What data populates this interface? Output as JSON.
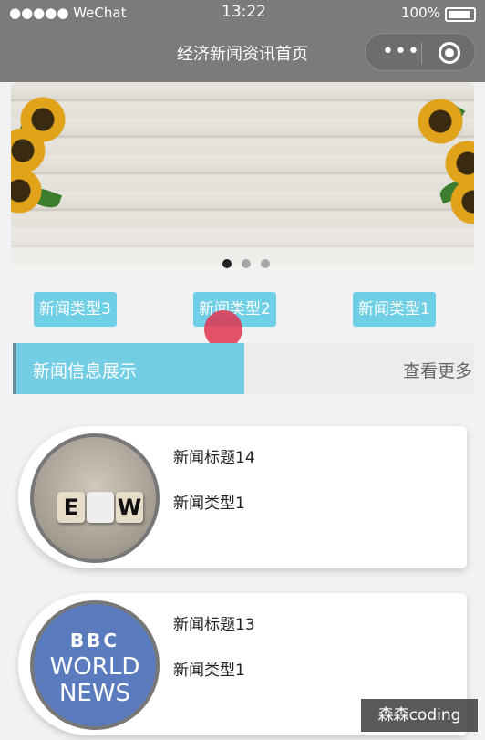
{
  "status_bar": {
    "carrier": "●●●●● WeChat",
    "time": "13:22",
    "battery": "100%"
  },
  "nav": {
    "title": "经济新闻资讯首页",
    "more_icon": "more-dots-icon",
    "close_icon": "target-icon"
  },
  "banner": {
    "indicator_count": 3,
    "active_index": 0
  },
  "categories": [
    {
      "label": "新闻类型3"
    },
    {
      "label": "新闻类型2"
    },
    {
      "label": "新闻类型1"
    }
  ],
  "section": {
    "title": "新闻信息展示",
    "more": "查看更多"
  },
  "news": [
    {
      "title": "新闻标题14",
      "type": "新闻类型1",
      "thumb_tiles": [
        "E",
        "W"
      ]
    },
    {
      "title": "新闻标题13",
      "type": "新闻类型1",
      "thumb_logo": "BBC",
      "thumb_line1": "WORLD",
      "thumb_line2": "NEWS"
    }
  ],
  "watermark": "森森coding",
  "colors": {
    "nav_bg": "#7b7b7b",
    "accent": "#6fcfe6",
    "section_bg": "#73cde5",
    "press_marker": "#e0344f"
  }
}
